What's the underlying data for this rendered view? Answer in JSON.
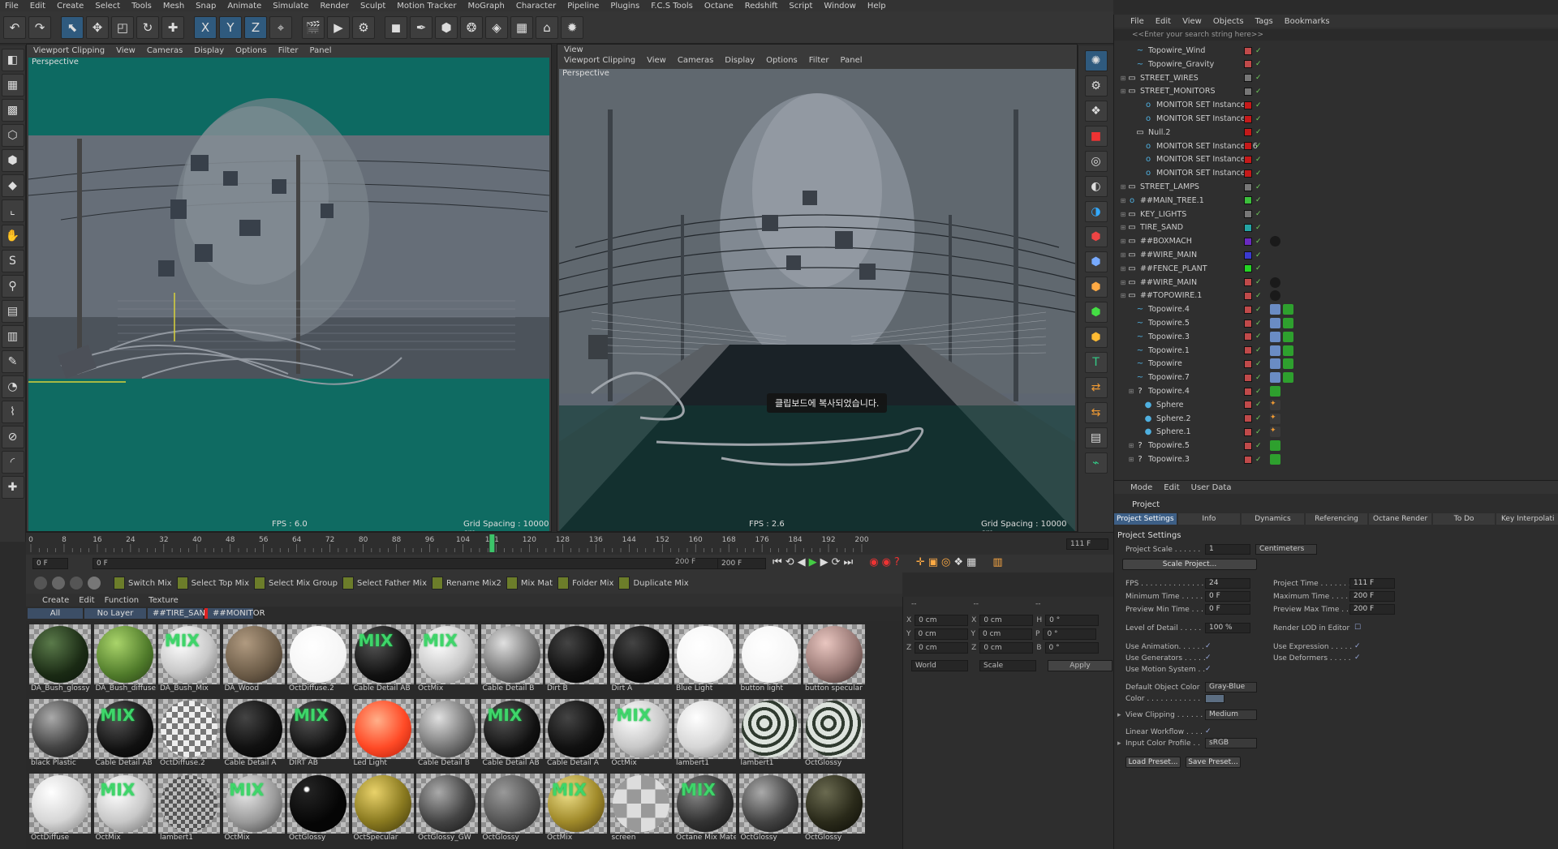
{
  "menu": [
    "File",
    "Edit",
    "Create",
    "Select",
    "Tools",
    "Mesh",
    "Snap",
    "Animate",
    "Simulate",
    "Render",
    "Sculpt",
    "Motion Tracker",
    "MoGraph",
    "Character",
    "Pipeline",
    "Plugins",
    "F.C.S Tools",
    "Octane",
    "Redshift",
    "Script",
    "Window",
    "Help"
  ],
  "toolbar_icons": [
    "undo-icon",
    "redo-icon",
    "live-select-icon",
    "move-icon",
    "scale-icon",
    "rotate-icon",
    "add-icon",
    "x-axis-icon",
    "y-axis-icon",
    "z-axis-icon",
    "coordinate-system-icon",
    "render-view-icon",
    "render-picture-viewer-icon",
    "render-settings-icon",
    "cube-icon",
    "pen-icon",
    "subdivision-icon",
    "array-icon",
    "deformer-icon",
    "floor-icon",
    "camera-icon",
    "light-icon"
  ],
  "viewport_left": {
    "menu": [
      "Viewport Clipping",
      "View",
      "Cameras",
      "Display",
      "Options",
      "Filter",
      "Panel"
    ],
    "label": "Perspective",
    "fps": "FPS : 6.0",
    "grid": "Grid Spacing : 10000 cm"
  },
  "viewport_right": {
    "title": "View",
    "menu": [
      "Viewport Clipping",
      "View",
      "Cameras",
      "Display",
      "Options",
      "Filter",
      "Panel"
    ],
    "label": "Perspective",
    "fps": "FPS : 2.6",
    "grid": "Grid Spacing : 10000 cm",
    "toast": "클립보드에 복사되었습니다."
  },
  "timeline": {
    "ticks": [
      "0",
      "8",
      "16",
      "24",
      "32",
      "40",
      "48",
      "56",
      "64",
      "72",
      "80",
      "88",
      "96",
      "104",
      "111",
      "120",
      "128",
      "136",
      "144",
      "152",
      "160",
      "168",
      "176",
      "184",
      "192",
      "200"
    ],
    "current": "111 F",
    "start": "0 F",
    "start2": "0 F",
    "end": "200 F",
    "end2": "200 F",
    "current_frame": 111,
    "total_frames": 200
  },
  "material_toolbar": [
    "Switch Mix",
    "Select Top Mix",
    "Select Mix Group",
    "Select Father Mix",
    "Rename Mix2",
    "Mix Mat",
    "Folder Mix",
    "Duplicate Mix"
  ],
  "material_menu": [
    "Create",
    "Edit",
    "Function",
    "Texture"
  ],
  "material_filters": [
    "All",
    "No Layer",
    "##TIRE_SAND",
    "##MONITOR"
  ],
  "mix_label": "MIX",
  "materials": [
    {
      "name": "DA_Bush_glossy",
      "style": "leaf-dark"
    },
    {
      "name": "DA_Bush_diffuse",
      "style": "leaf-green"
    },
    {
      "name": "DA_Bush_Mix",
      "style": "white-mix"
    },
    {
      "name": "DA_Wood",
      "style": "wood"
    },
    {
      "name": "OctDiffuse.2",
      "style": "white-flat"
    },
    {
      "name": "Cable Detail AB",
      "style": "black-mix"
    },
    {
      "name": "OctMix",
      "style": "white-mix"
    },
    {
      "name": "Cable Detail B",
      "style": "grey"
    },
    {
      "name": "Dirt B",
      "style": "black"
    },
    {
      "name": "Dirt A",
      "style": "black"
    },
    {
      "name": "Blue Light",
      "style": "white-flat"
    },
    {
      "name": "button light",
      "style": "white-flat"
    },
    {
      "name": "button specular",
      "style": "pink-grain"
    },
    {
      "name": "black Plastic",
      "style": "dark-grey"
    },
    {
      "name": "Cable Detail AB",
      "style": "black-mix"
    },
    {
      "name": "OctDiffuse.2",
      "style": "checker"
    },
    {
      "name": "Cable Detail A",
      "style": "black"
    },
    {
      "name": "DIRT AB",
      "style": "black-mix"
    },
    {
      "name": "Led Light",
      "style": "red"
    },
    {
      "name": "Cable Detail B",
      "style": "grey"
    },
    {
      "name": "Cable Detail AB",
      "style": "black-mix"
    },
    {
      "name": "Cable Detail A",
      "style": "black"
    },
    {
      "name": "OctMix",
      "style": "white-mix"
    },
    {
      "name": "lambert1",
      "style": "white"
    },
    {
      "name": "lambert1",
      "style": "leaf-pattern"
    },
    {
      "name": "OctGlossy",
      "style": "leaf-pattern"
    },
    {
      "name": "OctDiffuse",
      "style": "white"
    },
    {
      "name": "OctMix",
      "style": "white-mix"
    },
    {
      "name": "lambert1",
      "style": "checker-grey"
    },
    {
      "name": "OctMix",
      "style": "grey-mix"
    },
    {
      "name": "OctGlossy",
      "style": "black-glossy"
    },
    {
      "name": "OctSpecular",
      "style": "gold"
    },
    {
      "name": "OctGlossy_GW",
      "style": "dark-grey"
    },
    {
      "name": "OctGlossy",
      "style": "stone"
    },
    {
      "name": "OctMix",
      "style": "gold-mix"
    },
    {
      "name": "screen",
      "style": "checker-big"
    },
    {
      "name": "Octane Mix Mate",
      "style": "dark-mix"
    },
    {
      "name": "OctGlossy",
      "style": "dark-grey"
    },
    {
      "name": "OctGlossy",
      "style": "green-dark"
    }
  ],
  "coords": {
    "header": [
      "--",
      "--",
      "--"
    ],
    "rows": [
      {
        "a": "X",
        "av": "0 cm",
        "b": "X",
        "bv": "0 cm",
        "c": "H",
        "cv": "0 °"
      },
      {
        "a": "Y",
        "av": "0 cm",
        "b": "Y",
        "bv": "0 cm",
        "c": "P",
        "cv": "0 °"
      },
      {
        "a": "Z",
        "av": "0 cm",
        "b": "Z",
        "bv": "0 cm",
        "c": "B",
        "cv": "0 °"
      }
    ],
    "world": "World",
    "scale": "Scale",
    "apply": "Apply"
  },
  "object_manager": {
    "menu": [
      "File",
      "Edit",
      "View",
      "Objects",
      "Tags",
      "Bookmarks"
    ],
    "search": "<<Enter your search string here>>",
    "rows": [
      {
        "label": "Topowire_Wind",
        "indent": 1,
        "icon": "~",
        "color": "#c04a4a"
      },
      {
        "label": "Topowire_Gravity",
        "indent": 1,
        "icon": "~",
        "color": "#c04a4a"
      },
      {
        "label": "STREET_WIRES",
        "indent": 0,
        "icon": "L0",
        "color": "#777"
      },
      {
        "label": "STREET_MONITORS",
        "indent": 0,
        "icon": "L0",
        "color": "#777"
      },
      {
        "label": "MONITOR SET Instance.1",
        "indent": 2,
        "icon": "o",
        "color": "#c41a1a"
      },
      {
        "label": "MONITOR SET Instance",
        "indent": 2,
        "icon": "o",
        "color": "#c41a1a"
      },
      {
        "label": "Null.2",
        "indent": 1,
        "icon": "L0",
        "color": "#c41a1a"
      },
      {
        "label": "MONITOR SET Instance.26",
        "indent": 2,
        "icon": "o",
        "color": "#c41a1a"
      },
      {
        "label": "MONITOR SET Instance.3",
        "indent": 2,
        "icon": "o",
        "color": "#c41a1a"
      },
      {
        "label": "MONITOR SET Instance.2",
        "indent": 2,
        "icon": "o",
        "color": "#c41a1a"
      },
      {
        "label": "STREET_LAMPS",
        "indent": 0,
        "icon": "L0",
        "color": "#777"
      },
      {
        "label": "##MAIN_TREE.1",
        "indent": 0,
        "icon": "o",
        "color": "#3cbf3c"
      },
      {
        "label": "KEY_LIGHTS",
        "indent": 0,
        "icon": "L0",
        "color": "#777"
      },
      {
        "label": "TIRE_SAND",
        "indent": 0,
        "icon": "L0",
        "color": "#24a4a4"
      },
      {
        "label": "##BOXMACH",
        "indent": 0,
        "icon": "L0",
        "color": "#6a2ac0"
      },
      {
        "label": "##WIRE_MAIN",
        "indent": 0,
        "icon": "L0",
        "color": "#3a3ad0"
      },
      {
        "label": "##FENCE_PLANT",
        "indent": 0,
        "icon": "L0",
        "color": "#24d424"
      },
      {
        "label": "##WIRE_MAIN",
        "indent": 0,
        "icon": "L0",
        "color": "#c04a4a"
      },
      {
        "label": "##TOPOWIRE.1",
        "indent": 0,
        "icon": "L0",
        "color": "#c04a4a"
      },
      {
        "label": "Topowire.4",
        "indent": 1,
        "icon": "~",
        "color": "#c04a4a"
      },
      {
        "label": "Topowire.5",
        "indent": 1,
        "icon": "~",
        "color": "#c04a4a"
      },
      {
        "label": "Topowire.3",
        "indent": 1,
        "icon": "~",
        "color": "#c04a4a"
      },
      {
        "label": "Topowire.1",
        "indent": 1,
        "icon": "~",
        "color": "#c04a4a"
      },
      {
        "label": "Topowire",
        "indent": 1,
        "icon": "~",
        "color": "#c04a4a"
      },
      {
        "label": "Topowire.7",
        "indent": 1,
        "icon": "~",
        "color": "#c04a4a"
      },
      {
        "label": "Topowire.4",
        "indent": 1,
        "icon": "?",
        "color": "#c04a4a"
      },
      {
        "label": "Sphere",
        "indent": 2,
        "icon": "●",
        "color": "#c04a4a"
      },
      {
        "label": "Sphere.2",
        "indent": 2,
        "icon": "●",
        "color": "#c04a4a"
      },
      {
        "label": "Sphere.1",
        "indent": 2,
        "icon": "●",
        "color": "#c04a4a"
      },
      {
        "label": "Topowire.5",
        "indent": 1,
        "icon": "?",
        "color": "#c04a4a"
      },
      {
        "label": "Topowire.3",
        "indent": 1,
        "icon": "?",
        "color": "#c04a4a"
      }
    ]
  },
  "attributes": {
    "menu": [
      "Mode",
      "Edit",
      "User Data"
    ],
    "object": "Project",
    "tabs": [
      "Project Settings",
      "Info",
      "Dynamics",
      "Referencing",
      "Octane Render",
      "To Do",
      "Key Interpolati"
    ],
    "section": "Project Settings",
    "project_scale_label": "Project Scale . . . . . .",
    "project_scale": "1",
    "project_scale_unit": "Centimeters",
    "scale_project": "Scale Project...",
    "fps_label": "FPS . . . . . . . . . . . . . .",
    "fps": "24",
    "project_time_label": "Project Time . . . . . . .",
    "project_time": "111 F",
    "min_time_label": "Minimum Time . . . . .",
    "min_time": "0 F",
    "max_time_label": "Maximum Time . . . . .",
    "max_time": "200 F",
    "prev_min_label": "Preview Min Time . . .",
    "prev_min": "0 F",
    "prev_max_label": "Preview Max Time . . .",
    "prev_max": "200 F",
    "lod_label": "Level of Detail . . . . .",
    "lod": "100 %",
    "render_lod": "Render LOD in Editor",
    "use_animation": "Use Animation. . . . . .",
    "use_expression": "Use Expression . . . . .",
    "use_generators": "Use Generators . . . . .",
    "use_deformers": "Use Deformers . . . . .",
    "use_motion": "Use Motion System . .",
    "default_color_label": "Default Object Color",
    "default_color": "Gray-Blue",
    "color_label": "Color . . . . . . . . . . . .",
    "view_clipping_label": "View Clipping . . . . . .",
    "view_clipping": "Medium",
    "linear_workflow": "Linear Workflow . . . .",
    "input_color_label": "Input Color Profile . .",
    "input_color": "sRGB",
    "load_preset": "Load Preset...",
    "save_preset": "Save Preset..."
  }
}
